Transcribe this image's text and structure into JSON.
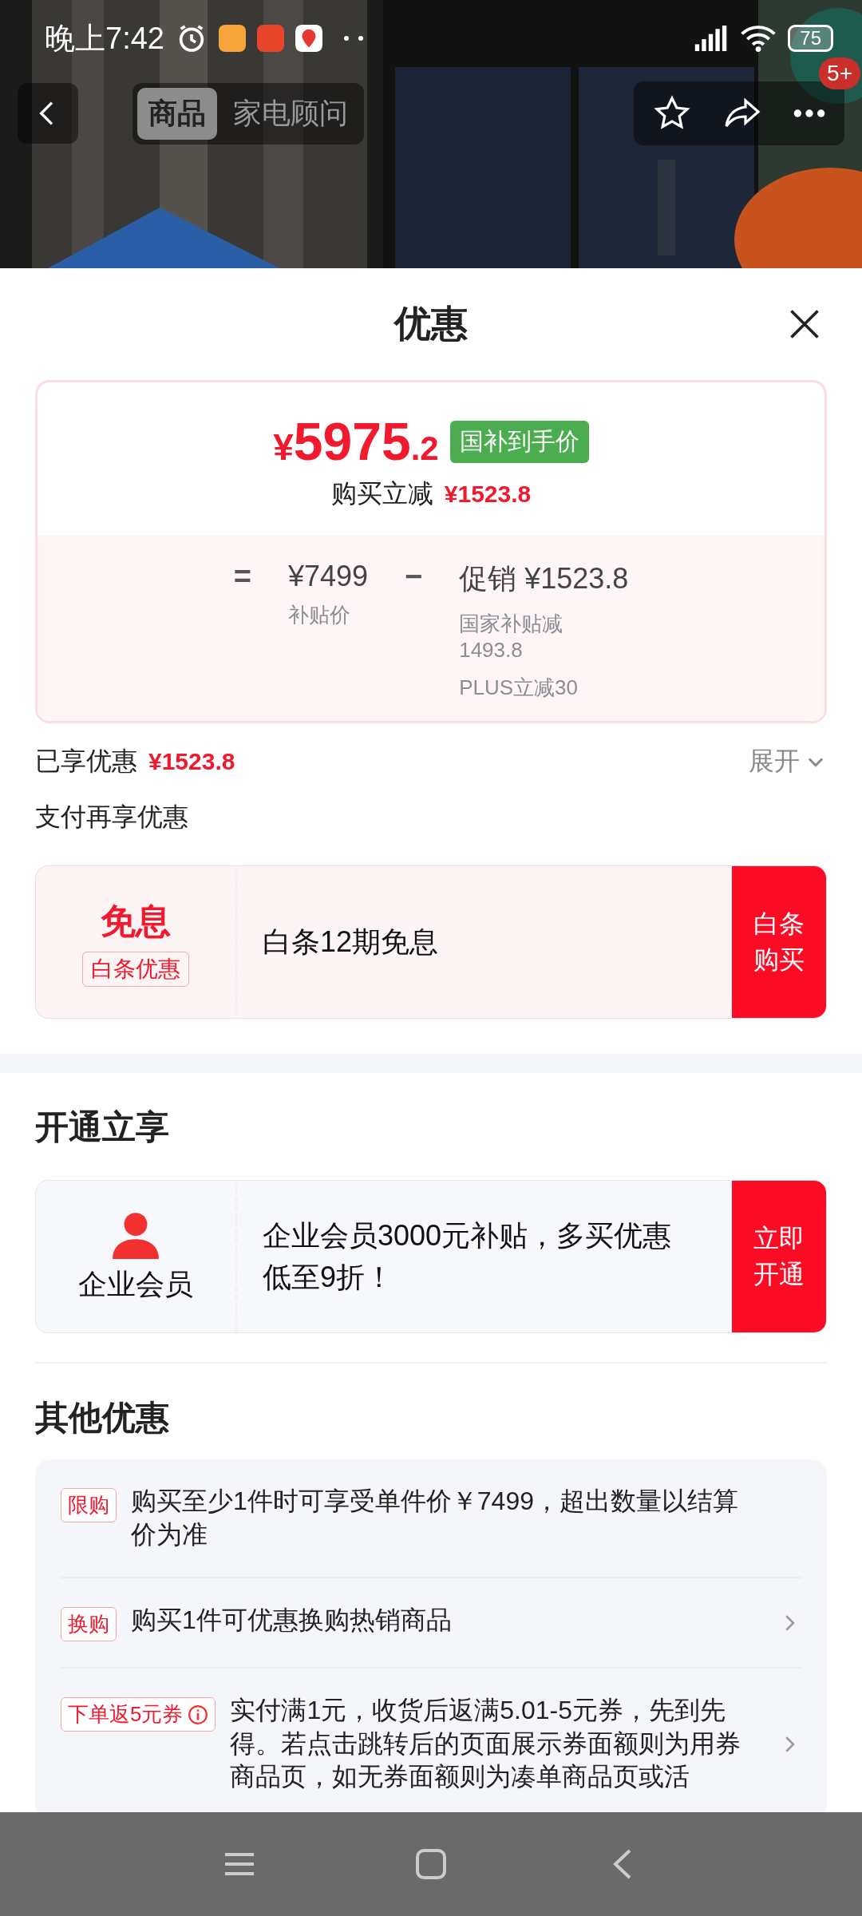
{
  "status_bar": {
    "time": "晚上7:42",
    "battery": "75"
  },
  "top_nav": {
    "tabs": [
      {
        "label": "商品",
        "selected": true
      },
      {
        "label": "家电顾问",
        "selected": false
      }
    ],
    "badge": "5+"
  },
  "sheet": {
    "title": "优惠"
  },
  "price_card": {
    "currency": "¥",
    "price_main": "5975",
    "price_decimal": ".2",
    "price_tag": "国补到手价",
    "savings_label": "购买立减",
    "savings_value": "¥1523.8",
    "equals": "=",
    "base_price": "¥7499",
    "base_label": "补贴价",
    "minus": "−",
    "promo_label": "促销 ¥1523.8",
    "promo_details": [
      "国家补贴减1493.8",
      "PLUS立减30"
    ]
  },
  "enjoyed": {
    "label": "已享优惠",
    "value": "¥1523.8",
    "expand": "展开",
    "expanded": false
  },
  "pay_section": {
    "title": "支付再享优惠",
    "offer": {
      "title": "免息",
      "tag": "白条优惠",
      "text": "白条12期免息",
      "button": "白条购买"
    }
  },
  "open_section": {
    "title": "开通立享",
    "offer": {
      "label": "企业会员",
      "text": "企业会员3000元补贴，多买优惠低至9折！",
      "button": "立即开通"
    }
  },
  "other_section": {
    "title": "其他优惠",
    "items": [
      {
        "tag": "限购",
        "text": "购买至少1件时可享受单件价￥7499，超出数量以结算价为准",
        "info": false,
        "arrow": false
      },
      {
        "tag": "换购",
        "text": "购买1件可优惠换购热销商品",
        "info": false,
        "arrow": true
      },
      {
        "tag": "下单返5元券",
        "text": "实付满1元，收货后返满5.01-5元券，先到先得。若点击跳转后的页面展示券面额则为用券商品页，如无券面额则为凑单商品页或活",
        "info": true,
        "arrow": true
      }
    ]
  }
}
